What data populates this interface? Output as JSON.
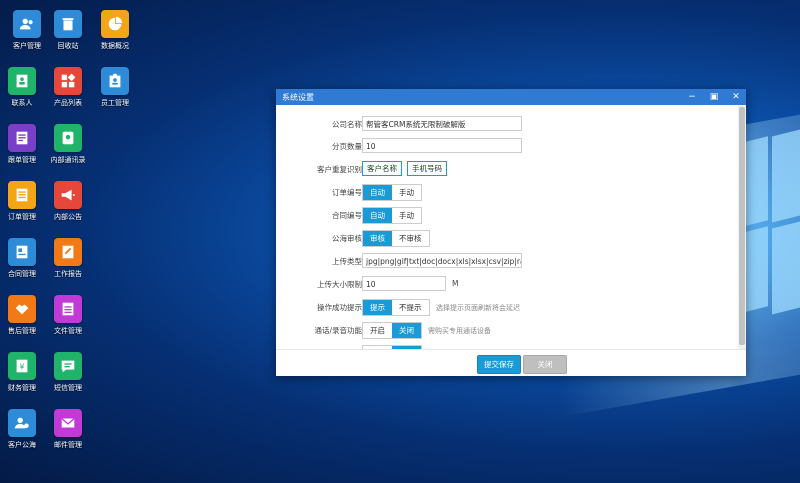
{
  "desktop": {
    "icons": [
      {
        "label": "客户管理",
        "icon": "users-icon",
        "color": "#2d8bd8"
      },
      {
        "label": "回收站",
        "icon": "trash-icon",
        "color": "#2d8bd8"
      },
      {
        "label": "数据概况",
        "icon": "pie-chart-icon",
        "color": "#f2a516"
      },
      {
        "label": "联系人",
        "icon": "contact-icon",
        "color": "#20b46a"
      },
      {
        "label": "产品列表",
        "icon": "product-grid-icon",
        "color": "#e5483a"
      },
      {
        "label": "员工管理",
        "icon": "badge-icon",
        "color": "#2d8bd8"
      },
      {
        "label": "跟单管理",
        "icon": "folder-icon",
        "color": "#7a3fc7"
      },
      {
        "label": "内部通讯录",
        "icon": "address-book-icon",
        "color": "#20b46a"
      },
      {
        "label": "订单管理",
        "icon": "document-icon",
        "color": "#f2a516"
      },
      {
        "label": "内部公告",
        "icon": "megaphone-icon",
        "color": "#e5483a"
      },
      {
        "label": "合同管理",
        "icon": "contract-icon",
        "color": "#2d8bd8"
      },
      {
        "label": "工作报告",
        "icon": "report-icon",
        "color": "#f27a16"
      },
      {
        "label": "售后管理",
        "icon": "handshake-icon",
        "color": "#f27a16"
      },
      {
        "label": "文件管理",
        "icon": "file-icon",
        "color": "#c23ad6"
      },
      {
        "label": "财务管理",
        "icon": "finance-icon",
        "color": "#20b46a"
      },
      {
        "label": "短信管理",
        "icon": "message-icon",
        "color": "#20b46a"
      },
      {
        "label": "客户公海",
        "icon": "customer-pool-icon",
        "color": "#2d8bd8"
      },
      {
        "label": "邮件管理",
        "icon": "mail-icon",
        "color": "#c23ad6"
      }
    ]
  },
  "dialog": {
    "title": "系统设置",
    "company_label": "公司名称",
    "company_value": "帮管客CRM系统无限制破解版",
    "pagesize_label": "分页数量",
    "pagesize_value": "10",
    "dup_label": "客户重复识别",
    "dup_opt1": "客户名称",
    "dup_opt2": "手机号码",
    "order_label": "订单编号",
    "contract_label": "合同编号",
    "auto": "自动",
    "manual": "手动",
    "pool_label": "公海审核",
    "audit": "审核",
    "no_audit": "不审核",
    "upload_type_label": "上传类型",
    "upload_type_value": "jpg|png|gif|txt|doc|docx|xls|xlsx|csv|zip|rar",
    "upload_size_label": "上传大小限制",
    "upload_size_value": "10",
    "upload_size_unit": "M",
    "success_tip_label": "操作成功提示",
    "tip": "提示",
    "no_tip": "不提示",
    "success_tip_hint": "选择提示页面刷新将会延迟",
    "call_label": "通话/录音功能",
    "on": "开启",
    "off": "关闭",
    "call_hint": "需购买专用通话设备",
    "submit": "提交保存",
    "close": "关闭"
  }
}
